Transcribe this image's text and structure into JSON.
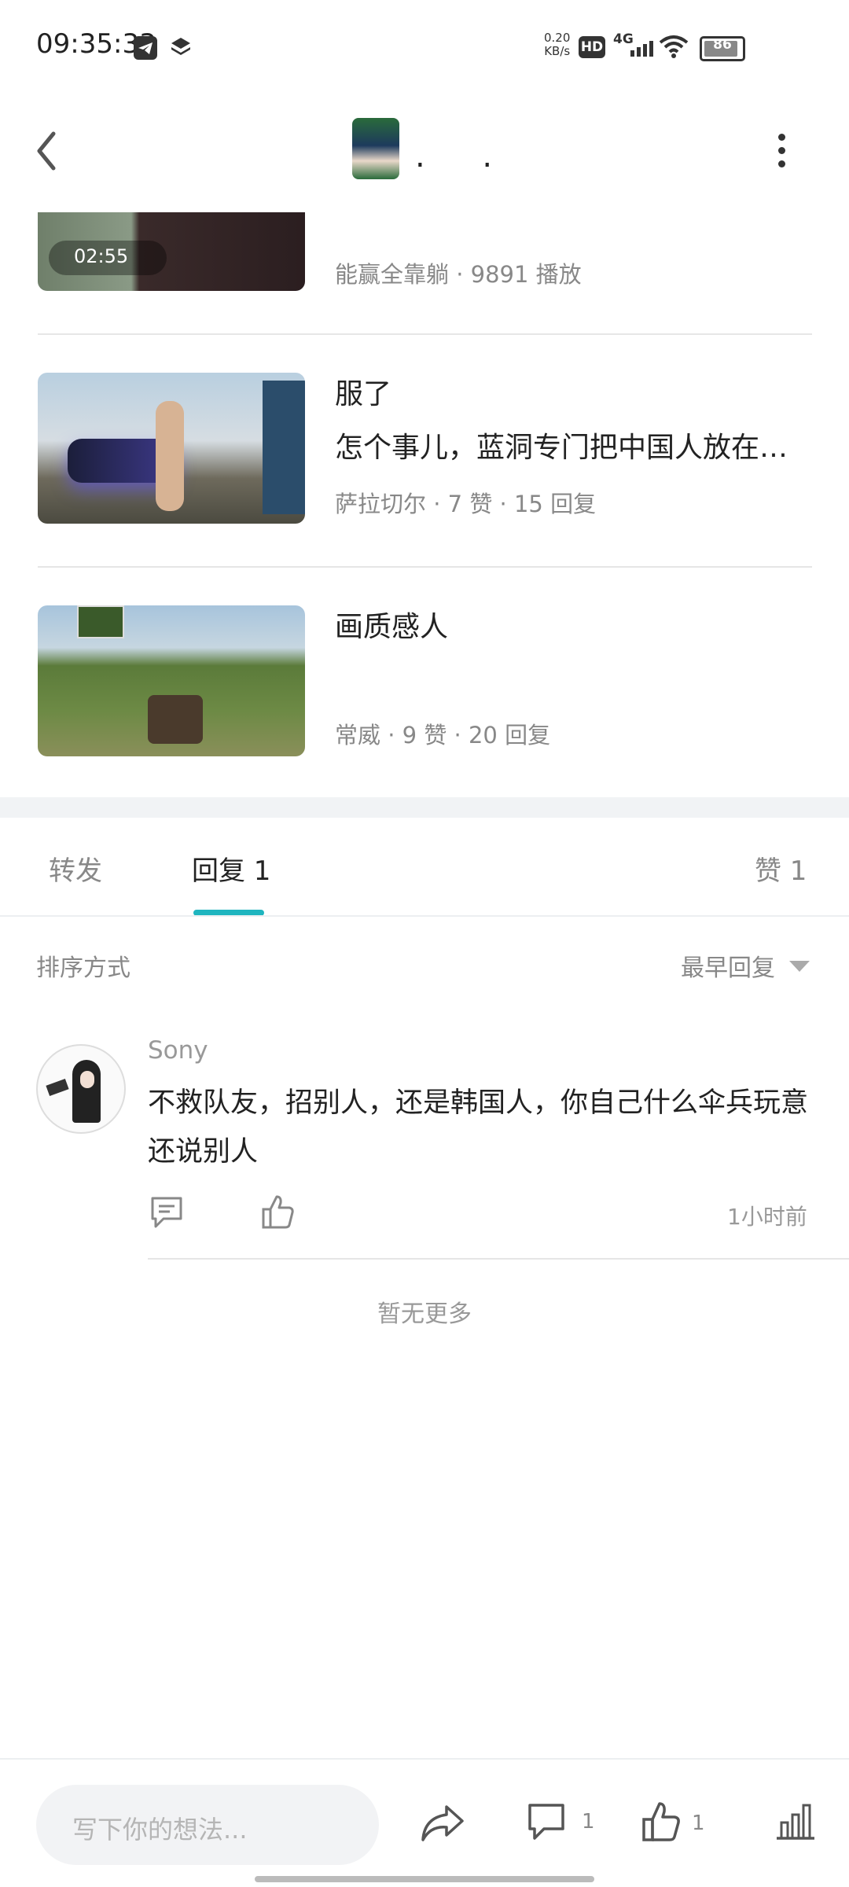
{
  "status_bar": {
    "time": "09:35:33",
    "network_speed": "0.20",
    "network_speed_unit": "KB/s",
    "hd_badge": "HD",
    "signal_label": "4G",
    "battery": "86"
  },
  "header": {
    "title": ". ."
  },
  "feed_items": [
    {
      "title": "",
      "meta": "能赢全靠躺 · 9891 播放",
      "duration": "02:55"
    },
    {
      "title": "服了",
      "subtitle": "怎个事儿，蓝洞专门把中国人放在…",
      "meta": "萨拉切尔 · 7 赞 · 15 回复"
    },
    {
      "title": "画质感人",
      "meta": "常威 · 9 赞 · 20 回复"
    }
  ],
  "tabs": [
    {
      "label": "转发"
    },
    {
      "label": "回复 1"
    },
    {
      "label": "赞 1"
    }
  ],
  "sort": {
    "label": "排序方式",
    "value": "最早回复"
  },
  "comment": {
    "author": "Sony",
    "text": "不救队友，招别人，还是韩国人，你自己什么伞兵玩意还说别人",
    "time": "1小时前"
  },
  "no_more": "暂无更多",
  "bottom_bar": {
    "input_placeholder": "写下你的想法...",
    "comment_count": "1",
    "like_count": "1"
  },
  "colors": {
    "accent": "#1fb5bf",
    "text_primary": "#222222",
    "text_secondary": "#888888"
  }
}
